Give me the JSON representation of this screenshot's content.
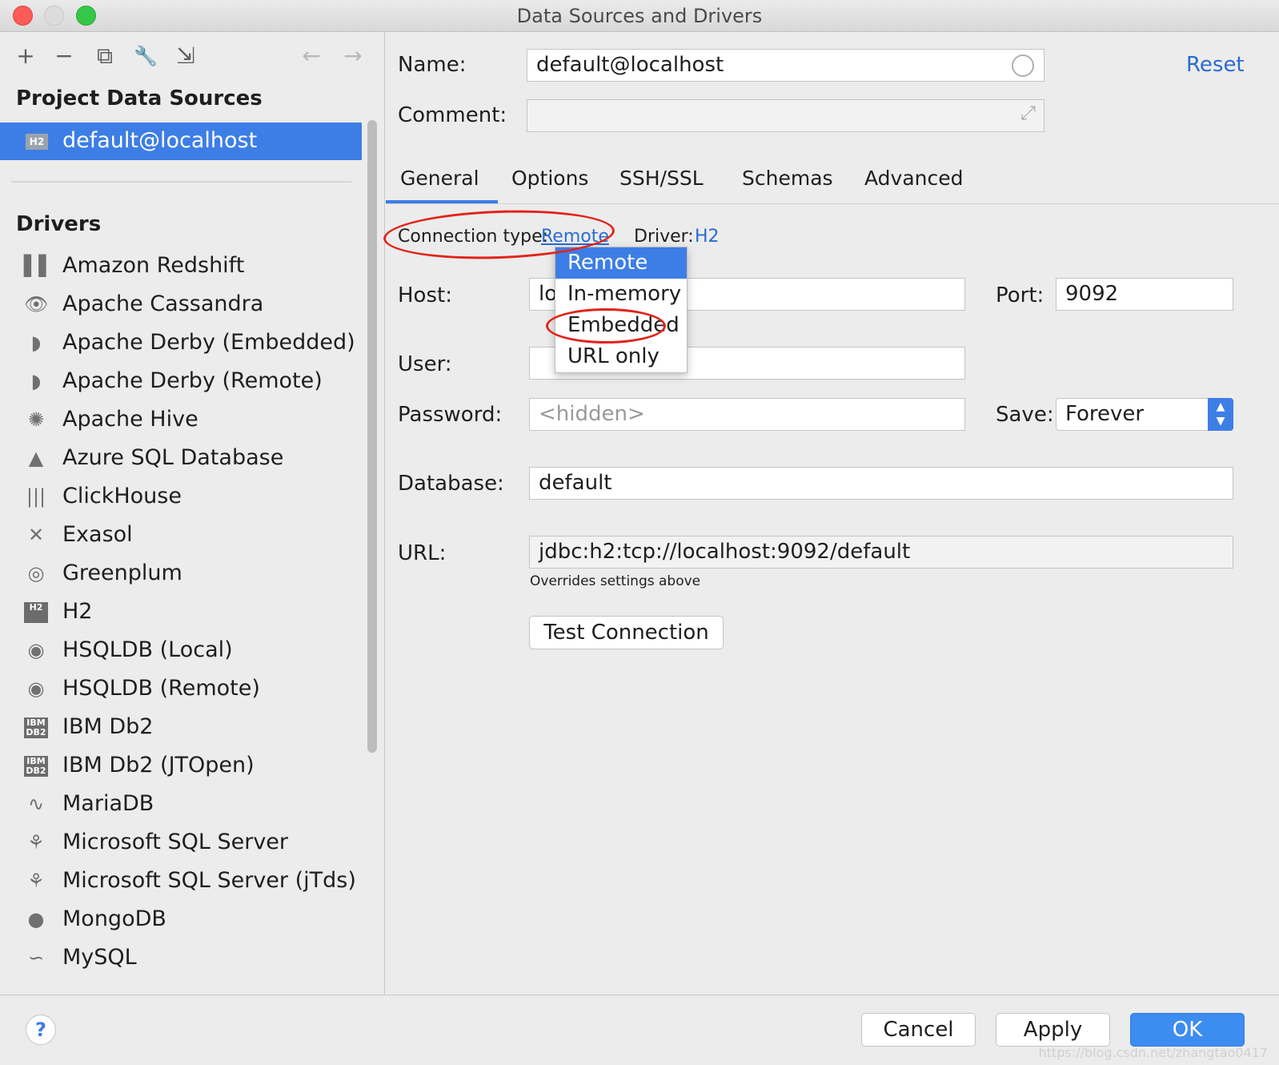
{
  "window": {
    "title": "Data Sources and Drivers"
  },
  "toolbar": {
    "add": "+",
    "remove": "−",
    "duplicate": "⧉",
    "settings": "🔧",
    "import": "⇲",
    "back": "←",
    "forward": "→"
  },
  "sidebar": {
    "project_title": "Project Data Sources",
    "selected_source": {
      "badge": "H2",
      "label": "default@localhost"
    },
    "drivers_title": "Drivers",
    "drivers": [
      {
        "icon": "amazon-redshift-icon",
        "glyph": "▌▌",
        "label": "Amazon Redshift"
      },
      {
        "icon": "cassandra-eye-icon",
        "glyph": "👁",
        "label": "Apache Cassandra"
      },
      {
        "icon": "derby-hat-icon",
        "glyph": "◗",
        "label": "Apache Derby (Embedded)"
      },
      {
        "icon": "derby-hat-icon",
        "glyph": "◗",
        "label": "Apache Derby (Remote)"
      },
      {
        "icon": "hive-bee-icon",
        "glyph": "✺",
        "label": "Apache Hive"
      },
      {
        "icon": "azure-triangle-icon",
        "glyph": "▲",
        "label": "Azure SQL Database"
      },
      {
        "icon": "clickhouse-bars-icon",
        "glyph": "|||",
        "label": "ClickHouse"
      },
      {
        "icon": "exasol-x-icon",
        "glyph": "✕",
        "label": "Exasol"
      },
      {
        "icon": "greenplum-circle-icon",
        "glyph": "◎",
        "label": "Greenplum"
      },
      {
        "icon": "h2-badge-icon",
        "glyph": "H2",
        "label": "H2"
      },
      {
        "icon": "hsqldb-icon",
        "glyph": "◉",
        "label": "HSQLDB (Local)"
      },
      {
        "icon": "hsqldb-icon",
        "glyph": "◉",
        "label": "HSQLDB (Remote)"
      },
      {
        "icon": "ibm-db2-icon",
        "glyph": "IBM DB2",
        "label": "IBM Db2"
      },
      {
        "icon": "ibm-db2-icon",
        "glyph": "IBM DB2",
        "label": "IBM Db2 (JTOpen)"
      },
      {
        "icon": "mariadb-seal-icon",
        "glyph": "∿",
        "label": "MariaDB"
      },
      {
        "icon": "sql-server-icon",
        "glyph": "⚘",
        "label": "Microsoft SQL Server"
      },
      {
        "icon": "sql-server-icon",
        "glyph": "⚘",
        "label": "Microsoft SQL Server (jTds)"
      },
      {
        "icon": "mongodb-leaf-icon",
        "glyph": "●",
        "label": "MongoDB"
      },
      {
        "icon": "mysql-dolphin-icon",
        "glyph": "∽",
        "label": "MySQL"
      }
    ]
  },
  "form": {
    "name_label": "Name:",
    "name_value": "default@localhost",
    "reset_label": "Reset",
    "comment_label": "Comment:",
    "comment_value": "",
    "tabs": [
      "General",
      "Options",
      "SSH/SSL",
      "Schemas",
      "Advanced"
    ],
    "active_tab": "General",
    "connection_type_label": "Connection type:",
    "connection_type_value": "Remote",
    "driver_label": "Driver:",
    "driver_value": "H2",
    "connection_type_options": [
      "Remote",
      "In-memory",
      "Embedded",
      "URL only"
    ],
    "host_label": "Host:",
    "host_value": "lo",
    "port_label": "Port:",
    "port_value": "9092",
    "user_label": "User:",
    "user_value": "",
    "password_label": "Password:",
    "password_placeholder": "<hidden>",
    "save_label": "Save:",
    "save_value": "Forever",
    "database_label": "Database:",
    "database_value": "default",
    "url_label": "URL:",
    "url_value": "jdbc:h2:tcp://localhost:9092/default",
    "url_hint": "Overrides settings above",
    "test_connection_label": "Test Connection"
  },
  "footer": {
    "help": "?",
    "cancel": "Cancel",
    "apply": "Apply",
    "ok": "OK",
    "watermark": "https://blog.csdn.net/zhangtao0417"
  },
  "colors": {
    "accent": "#3d7ee6",
    "link": "#2a6bd1",
    "annotation": "#e2231a"
  }
}
